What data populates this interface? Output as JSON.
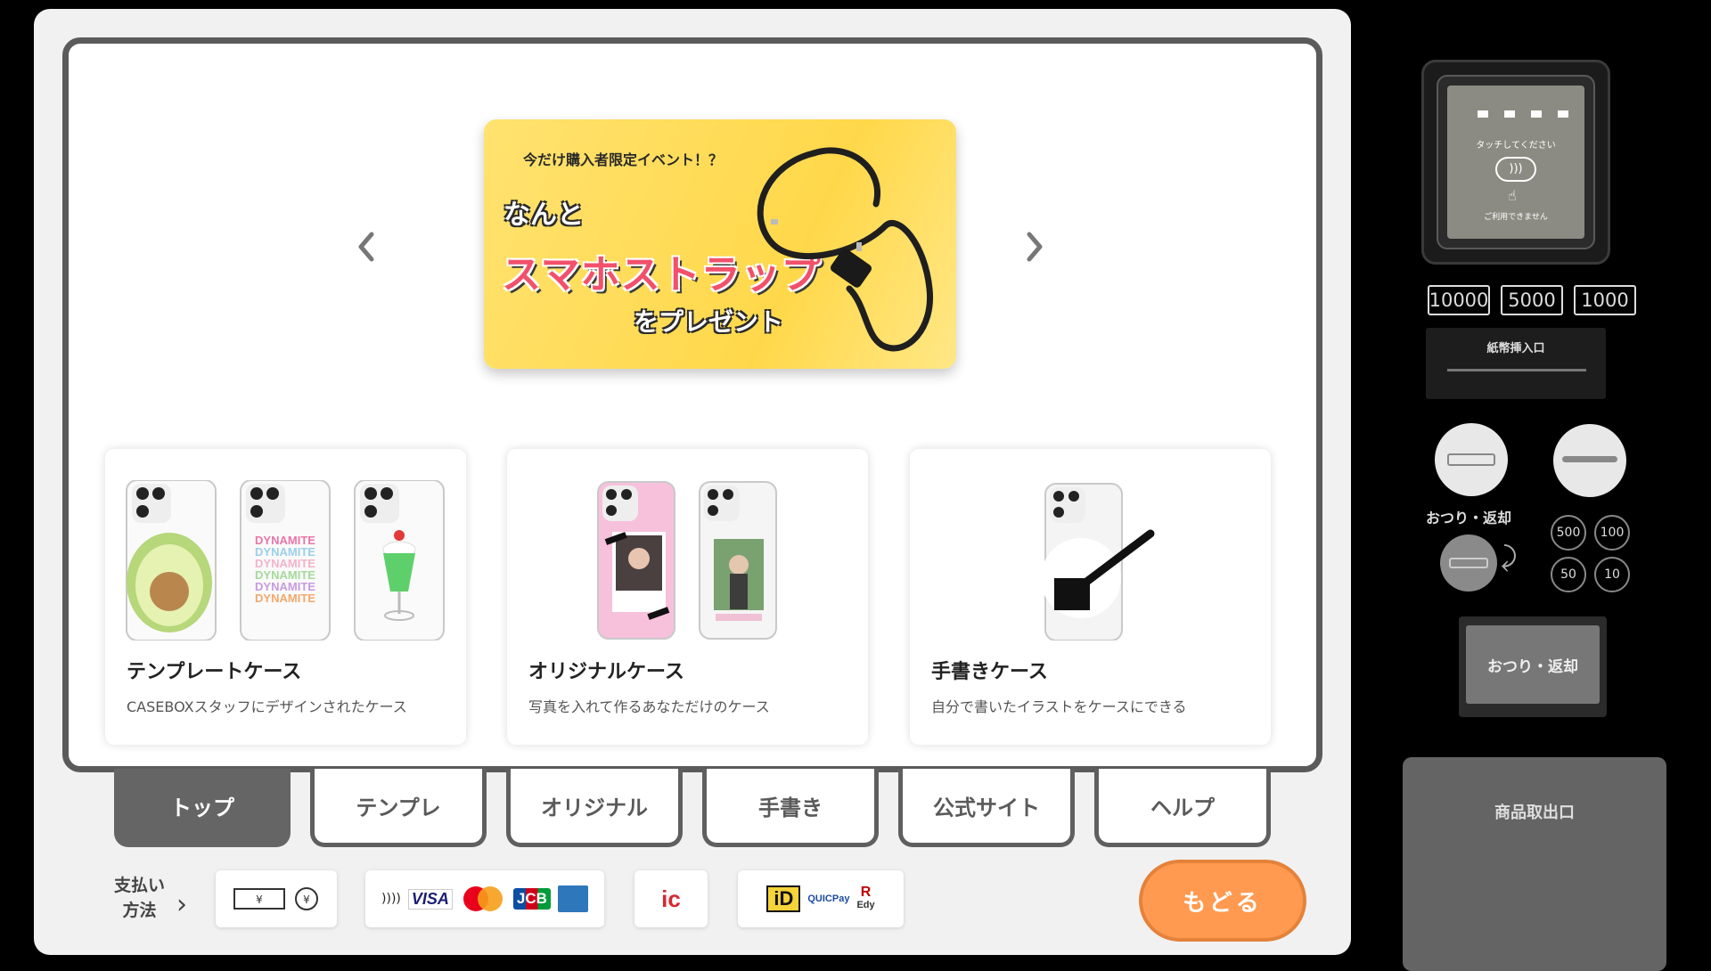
{
  "banner": {
    "tagline": "今だけ購入者限定イベント！？",
    "line1": "なんと",
    "line2": "スマホストラップ",
    "line3": "をプレゼント"
  },
  "cards": [
    {
      "title": "テンプレートケース",
      "desc": "CASEBOXスタッフにデザインされたケース",
      "sample_text": "DYNAMITE"
    },
    {
      "title": "オリジナルケース",
      "desc": "写真を入れて作るあなただけのケース"
    },
    {
      "title": "手書きケース",
      "desc": "自分で書いたイラストをケースにできる"
    }
  ],
  "tabs": [
    {
      "label": "トップ",
      "active": true
    },
    {
      "label": "テンプレ",
      "active": false
    },
    {
      "label": "オリジナル",
      "active": false
    },
    {
      "label": "手書き",
      "active": false
    },
    {
      "label": "公式サイト",
      "active": false
    },
    {
      "label": "ヘルプ",
      "active": false
    }
  ],
  "payment": {
    "label_line1": "支払い",
    "label_line2": "方法",
    "cash_symbol": "¥",
    "cards": [
      "VISA",
      "JCB"
    ],
    "ic_label": "ic",
    "emoney": [
      "iD",
      "QUICPay",
      "R",
      "Edy"
    ]
  },
  "back_button": "もどる",
  "hardware": {
    "reader_prompt": "タッチしてください",
    "reader_status": "ご利用できません",
    "bill_buttons": [
      "10000",
      "5000",
      "1000"
    ],
    "bill_slot": "紙幣挿入口",
    "change_label": "おつり・返却",
    "coins": [
      "500",
      "100",
      "50",
      "10"
    ],
    "change_button": "おつり・返却",
    "outlet": "商品取出口"
  },
  "colors": {
    "accent": "#ff9a50",
    "tab_active": "#656565",
    "banner": "#ffd84a"
  }
}
